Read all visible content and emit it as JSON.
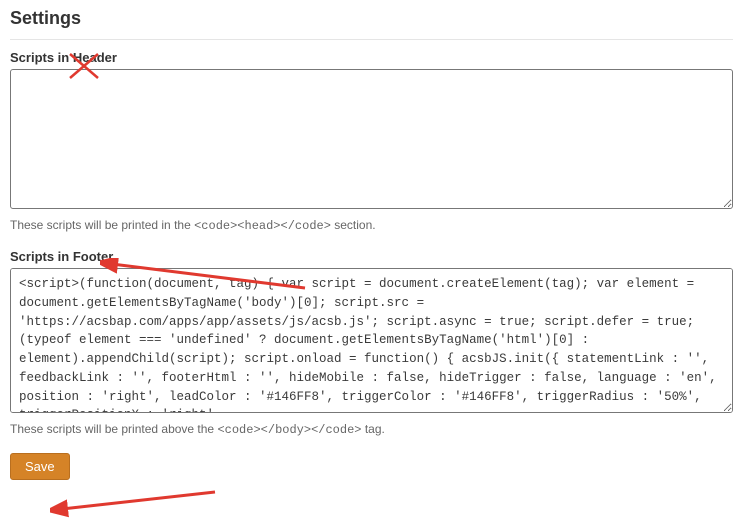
{
  "page": {
    "title": "Settings"
  },
  "header_section": {
    "label": "Scripts in Header",
    "value": "",
    "help_pre": "These scripts will be printed in the ",
    "help_code": "<code><head></code>",
    "help_post": " section."
  },
  "footer_section": {
    "label": "Scripts in Footer",
    "value": "<script>(function(document, tag) { var script = document.createElement(tag); var element = document.getElementsByTagName('body')[0]; script.src = 'https://acsbap.com/apps/app/assets/js/acsb.js'; script.async = true; script.defer = true; (typeof element === 'undefined' ? document.getElementsByTagName('html')[0] : element).appendChild(script); script.onload = function() { acsbJS.init({ statementLink : '', feedbackLink : '', footerHtml : '', hideMobile : false, hideTrigger : false, language : 'en', position : 'right', leadColor : '#146FF8', triggerColor : '#146FF8', triggerRadius : '50%', triggerPositionX : 'right',",
    "help_pre": "These scripts will be printed above the ",
    "help_code": "<code></body></code>",
    "help_post": " tag."
  },
  "actions": {
    "save": "Save"
  },
  "annotations": {
    "cross_color": "#e0392f",
    "arrow_color": "#e0392f"
  }
}
